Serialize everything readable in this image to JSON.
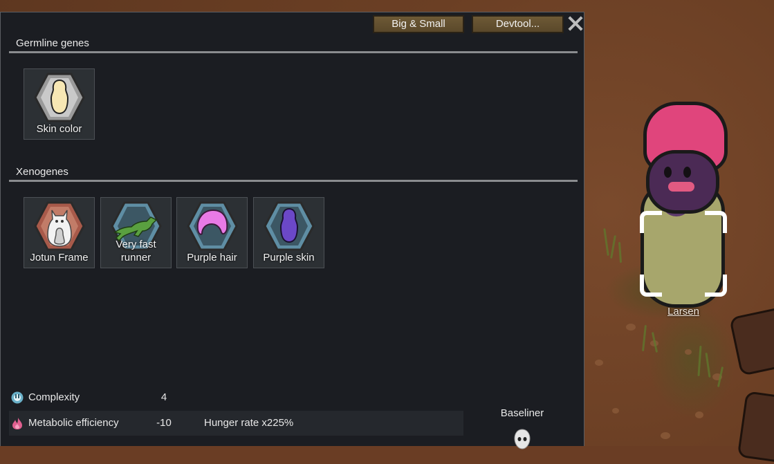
{
  "window": {
    "buttons": [
      {
        "label": "Big & Small"
      },
      {
        "label": "Devtool..."
      }
    ],
    "close_label": "Close"
  },
  "germline": {
    "title": "Germline genes",
    "genes": [
      {
        "label": "Skin color",
        "icon": "skin-color-icon"
      }
    ]
  },
  "xenogenes": {
    "title": "Xenogenes",
    "genes": [
      {
        "label": "Jotun Frame",
        "icon": "jotun-frame-icon"
      },
      {
        "label": "Very fast runner",
        "icon": "fast-runner-icon"
      },
      {
        "label": "Purple hair",
        "icon": "purple-hair-icon"
      },
      {
        "label": "Purple skin",
        "icon": "purple-skin-icon"
      }
    ]
  },
  "stats": [
    {
      "name": "Complexity",
      "value": "4",
      "description": "",
      "icon": "complexity-icon"
    },
    {
      "name": "Metabolic efficiency",
      "value": "-10",
      "description": "Hunger rate x225%",
      "icon": "metabolism-icon"
    }
  ],
  "xenotype": {
    "label": "Baseliner",
    "icon": "baseliner-icon"
  },
  "pawn": {
    "name": "Larsen"
  },
  "colors": {
    "panel_bg": "#1b1d22",
    "gene_tile_bg": "#2c3034",
    "button_bg": "#6e5a36",
    "hair": "#e0457c",
    "skin": "#4b2a55"
  }
}
